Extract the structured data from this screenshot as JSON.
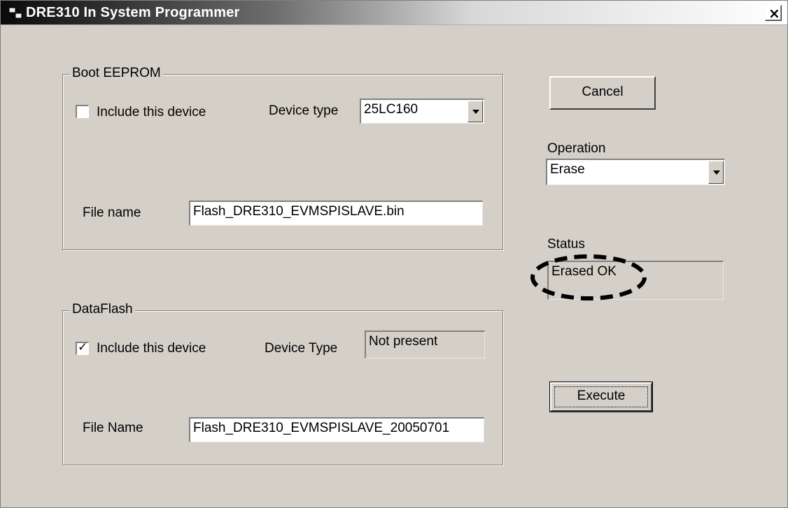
{
  "window": {
    "title": "DRE310 In System Programmer",
    "icon": "app-plug-icon",
    "close_label": "×"
  },
  "boot_eeprom": {
    "title": "Boot EEPROM",
    "include_label": "Include this device",
    "include_checked": false,
    "device_type_label": "Device type",
    "device_type_value": "25LC160",
    "file_name_label": "File name",
    "file_name_value": "Flash_DRE310_EVMSPISLAVE.bin"
  },
  "dataflash": {
    "title": "DataFlash",
    "include_label": "Include this device",
    "include_checked": true,
    "check_mark": "✓",
    "device_type_label": "Device Type",
    "device_type_value": "Not present",
    "file_name_label": "File Name",
    "file_name_value": "Flash_DRE310_EVMSPISLAVE_20050701"
  },
  "controls": {
    "cancel_label": "Cancel",
    "operation_label": "Operation",
    "operation_value": "Erase",
    "status_label": "Status",
    "status_value": "Erased OK",
    "execute_label": "Execute"
  }
}
